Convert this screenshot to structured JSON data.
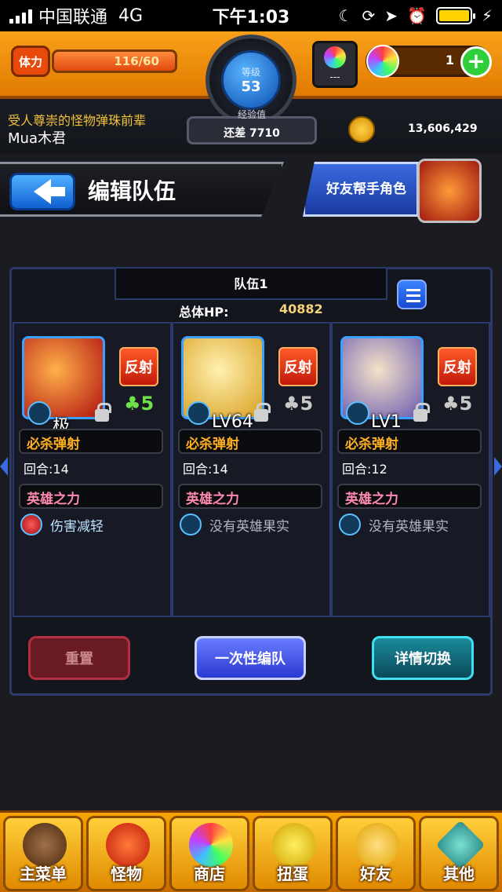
{
  "status_bar": {
    "carrier": "中国联通",
    "network": "4G",
    "time": "下午1:03"
  },
  "hud": {
    "stamina_label": "体力",
    "stamina_value": "116/60",
    "stamina_fraction": 1.0,
    "level_label": "等级",
    "level": "53",
    "gem_box_text": "---",
    "orb_count": "1",
    "add_symbol": "+",
    "player_title": "受人尊崇的怪物弹珠前辈",
    "player_name": "Mua木君",
    "exp_label": "经验值",
    "exp_value": "还差 7710",
    "coins": "13,606,429"
  },
  "header": {
    "title": "编辑队伍",
    "helper_button": "好友帮手角色"
  },
  "team": {
    "name": "队伍1",
    "hp_label": "总体HP:",
    "hp_value": "40882",
    "slots": [
      {
        "level_text": "极",
        "ability": "反射",
        "luck": "5",
        "luck_color": "#6ee04a",
        "strike_name": "必杀弹射",
        "turns": "回合:14",
        "hero_title": "英雄之力",
        "fruit": "伤害减轻"
      },
      {
        "level_text": "LV64",
        "ability": "反射",
        "luck": "5",
        "luck_color": "#c8c8c8",
        "strike_name": "必杀弹射",
        "turns": "回合:14",
        "hero_title": "英雄之力",
        "fruit": "没有英雄果实"
      },
      {
        "level_text": "LV1",
        "ability": "反射",
        "luck": "5",
        "luck_color": "#c8c8c8",
        "strike_name": "必杀弹射",
        "turns": "回合:12",
        "hero_title": "英雄之力",
        "fruit": "没有英雄果实"
      }
    ],
    "buttons": {
      "reset": "重置",
      "one_time": "一次性编队",
      "detail": "详情切换"
    }
  },
  "bottom_nav": [
    {
      "label": "主菜单",
      "icon": "main-menu-icon"
    },
    {
      "label": "怪物",
      "icon": "monster-icon"
    },
    {
      "label": "商店",
      "icon": "shop-orb-icon"
    },
    {
      "label": "扭蛋",
      "icon": "gacha-egg-icon"
    },
    {
      "label": "好友",
      "icon": "friends-balloon-icon"
    },
    {
      "label": "其他",
      "icon": "other-question-icon"
    }
  ]
}
